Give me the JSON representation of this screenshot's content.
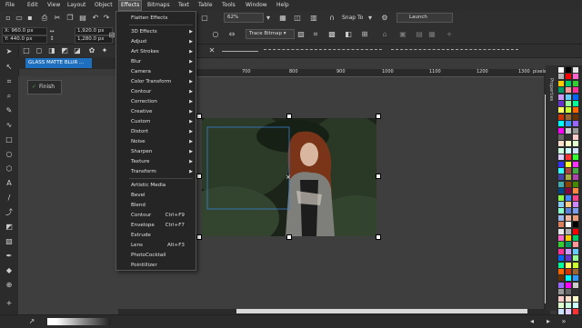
{
  "menubar": {
    "items": [
      "File",
      "Edit",
      "View",
      "Layout",
      "Object",
      "Effects",
      "Bitmaps",
      "Text",
      "Table",
      "Tools",
      "Window",
      "Help"
    ],
    "active": "Effects"
  },
  "toolbar1": {
    "zoom": "62%",
    "snap_to": "Snap To",
    "launch": "Launch"
  },
  "propbar": {
    "x": "X: 960.0 px",
    "y": "Y: 440.0 px",
    "w": "1,920.0 px",
    "h": "1,280.0 px",
    "trace_bitmap": "Trace Bitmap"
  },
  "doc_tab": "GLASS MATTE BLUR ...",
  "finish": "Finish",
  "ruler": [
    "700",
    "800",
    "900",
    "1000",
    "1100",
    "1200",
    "1300",
    "pixels"
  ],
  "dropdown": {
    "items": [
      {
        "label": "Flatten Effects",
        "shortcut": "",
        "submenu": false
      },
      {
        "label": "3D Effects",
        "shortcut": "",
        "submenu": true
      },
      {
        "label": "Adjust",
        "shortcut": "",
        "submenu": true
      },
      {
        "label": "Art Strokes",
        "shortcut": "",
        "submenu": true
      },
      {
        "label": "Blur",
        "shortcut": "",
        "submenu": true
      },
      {
        "label": "Camera",
        "shortcut": "",
        "submenu": true
      },
      {
        "label": "Color Transform",
        "shortcut": "",
        "submenu": true
      },
      {
        "label": "Contour",
        "shortcut": "",
        "submenu": true
      },
      {
        "label": "Correction",
        "shortcut": "",
        "submenu": true
      },
      {
        "label": "Creative",
        "shortcut": "",
        "submenu": true
      },
      {
        "label": "Custom",
        "shortcut": "",
        "submenu": true
      },
      {
        "label": "Distort",
        "shortcut": "",
        "submenu": true
      },
      {
        "label": "Noise",
        "shortcut": "",
        "submenu": true
      },
      {
        "label": "Sharpen",
        "shortcut": "",
        "submenu": true
      },
      {
        "label": "Texture",
        "shortcut": "",
        "submenu": true
      },
      {
        "label": "Transform",
        "shortcut": "",
        "submenu": true
      },
      {
        "label": "Artistic Media",
        "shortcut": "",
        "submenu": false
      },
      {
        "label": "Bevel",
        "shortcut": "",
        "submenu": false
      },
      {
        "label": "Blend",
        "shortcut": "",
        "submenu": false
      },
      {
        "label": "Contour",
        "shortcut": "Ctrl+F9",
        "submenu": false
      },
      {
        "label": "Envelope",
        "shortcut": "Ctrl+F7",
        "submenu": false
      },
      {
        "label": "Extrude",
        "shortcut": "",
        "submenu": false
      },
      {
        "label": "Lens",
        "shortcut": "Alt+F3",
        "submenu": false
      },
      {
        "label": "PhotoCocktail",
        "shortcut": "",
        "submenu": false
      },
      {
        "label": "Pointillizer",
        "shortcut": "",
        "submenu": false
      }
    ]
  },
  "side_panel_label": "Properties",
  "colors": {
    "accent": "#1e6fbd",
    "menu_bg": "#252525",
    "ui_bg": "#2f2f2f",
    "canvas_bg": "#3e3e3e"
  }
}
